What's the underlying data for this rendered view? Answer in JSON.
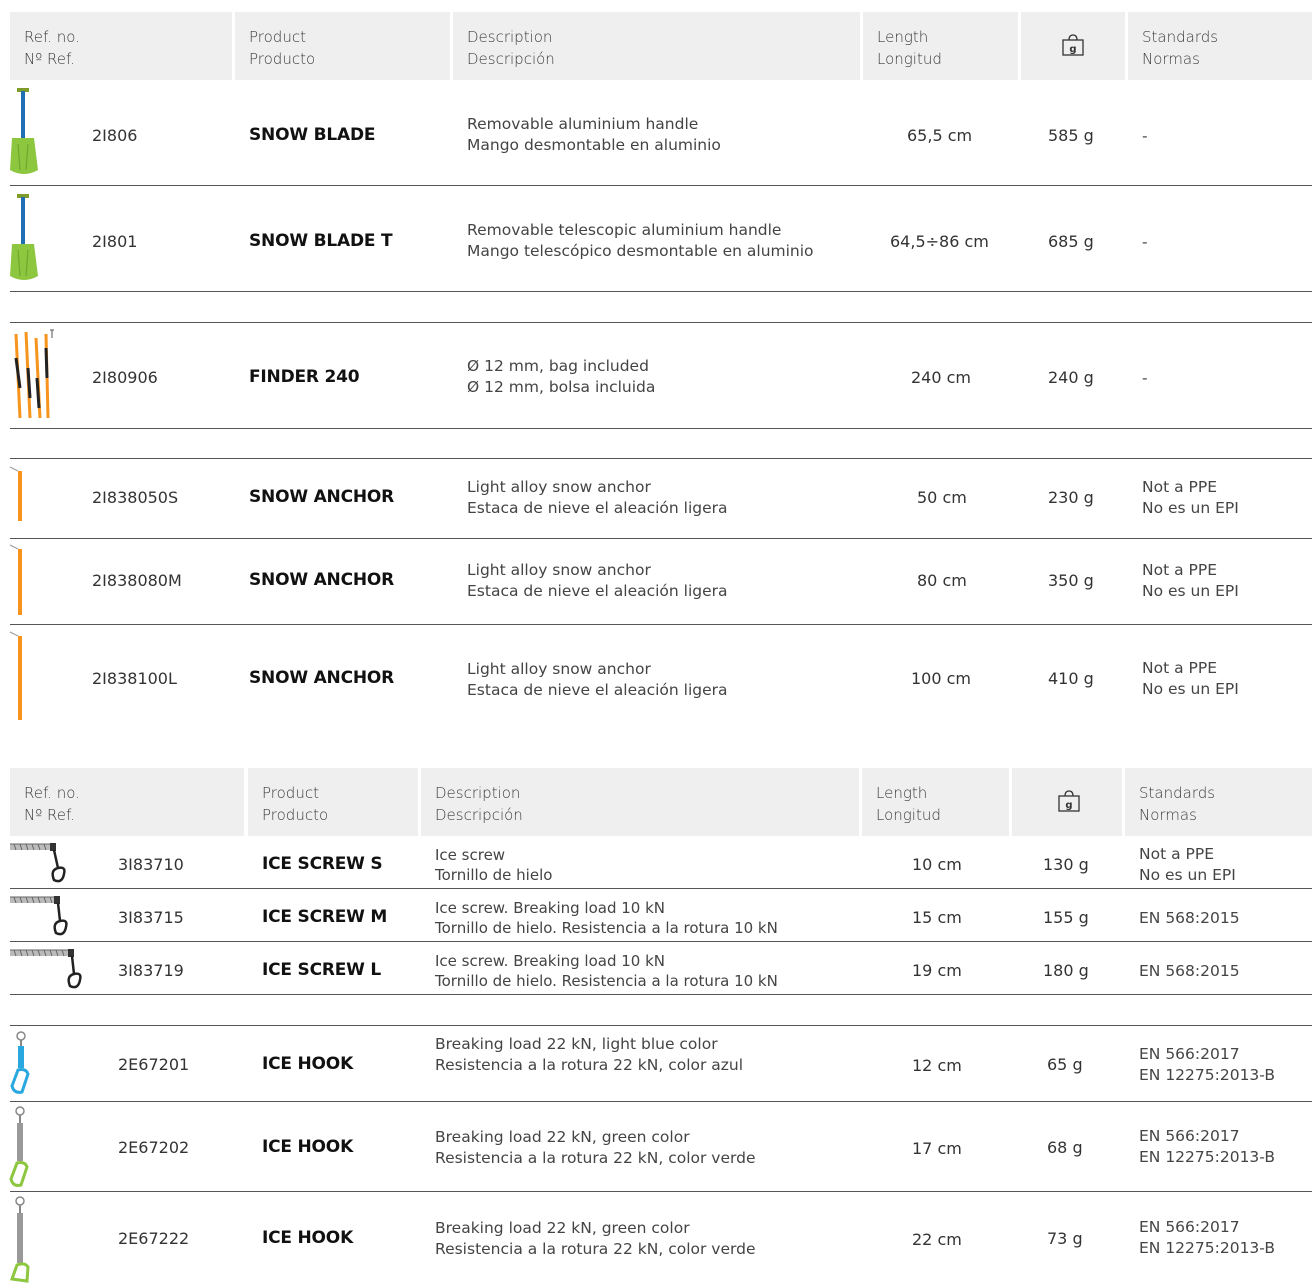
{
  "header": {
    "ref": [
      "Ref. no.",
      "Nº Ref."
    ],
    "product": [
      "Product",
      "Producto"
    ],
    "description": [
      "Description",
      "Descripción"
    ],
    "length": [
      "Length",
      "Longitud"
    ],
    "weight_icon_text": "g",
    "standards": [
      "Standards",
      "Normas"
    ]
  },
  "table1": {
    "rows": [
      {
        "ref": "2I806",
        "product": "SNOW BLADE",
        "desc": [
          "Removable aluminium handle",
          "Mango desmontable en aluminio"
        ],
        "length": "65,5 cm",
        "weight": "585 g",
        "std": [
          "-"
        ]
      },
      {
        "ref": "2I801",
        "product": "SNOW BLADE T",
        "desc": [
          "Removable telescopic aluminium handle",
          "Mango telescópico desmontable en aluminio"
        ],
        "length": "64,5÷86 cm",
        "weight": "685 g",
        "std": [
          "-"
        ]
      },
      {
        "ref": "2I80906",
        "product": "FINDER 240",
        "desc": [
          "Ø 12 mm, bag included",
          "Ø 12 mm, bolsa incluida"
        ],
        "length": "240 cm",
        "weight": "240 g",
        "std": [
          "-"
        ]
      },
      {
        "ref": "2I838050S",
        "product": "SNOW ANCHOR",
        "desc": [
          "Light alloy snow anchor",
          "Estaca de nieve el aleación ligera"
        ],
        "length": "50 cm",
        "weight": "230 g",
        "std": [
          "Not a PPE",
          "No es un EPI"
        ]
      },
      {
        "ref": "2I838080M",
        "product": "SNOW ANCHOR",
        "desc": [
          "Light alloy snow anchor",
          "Estaca de nieve el aleación ligera"
        ],
        "length": "80 cm",
        "weight": "350 g",
        "std": [
          "Not a PPE",
          "No es un EPI"
        ]
      },
      {
        "ref": "2I838100L",
        "product": "SNOW ANCHOR",
        "desc": [
          "Light alloy snow anchor",
          "Estaca de nieve el aleación ligera"
        ],
        "length": "100 cm",
        "weight": "410 g",
        "std": [
          "Not a PPE",
          "No es un EPI"
        ]
      }
    ]
  },
  "table2": {
    "rows": [
      {
        "ref": "3I83710",
        "product": "ICE SCREW S",
        "desc": [
          "Ice screw",
          "Tornillo de hielo"
        ],
        "length": "10 cm",
        "weight": "130 g",
        "std": [
          "Not a PPE",
          "No es un EPI"
        ]
      },
      {
        "ref": "3I83715",
        "product": "ICE SCREW M",
        "desc": [
          "Ice screw. Breaking load 10 kN",
          "Tornillo de hielo. Resistencia a la rotura 10 kN"
        ],
        "length": "15 cm",
        "weight": "155 g",
        "std": [
          "EN 568:2015"
        ]
      },
      {
        "ref": "3I83719",
        "product": "ICE SCREW L",
        "desc": [
          "Ice screw. Breaking load 10 kN",
          "Tornillo de hielo. Resistencia a la rotura 10 kN"
        ],
        "length": "19 cm",
        "weight": "180 g",
        "std": [
          "EN 568:2015"
        ]
      },
      {
        "ref": "2E67201",
        "product": "ICE HOOK",
        "desc": [
          "Breaking load 22 kN, light blue color",
          "Resistencia a la rotura 22 kN, color azul"
        ],
        "length": "12 cm",
        "weight": "65 g",
        "std": [
          "EN 566:2017",
          "EN 12275:2013-B"
        ]
      },
      {
        "ref": "2E67202",
        "product": "ICE HOOK",
        "desc": [
          "Breaking load 22 kN, green color",
          "Resistencia a la rotura 22 kN, color verde"
        ],
        "length": "17 cm",
        "weight": "68 g",
        "std": [
          "EN 566:2017",
          "EN 12275:2013-B"
        ]
      },
      {
        "ref": "2E67222",
        "product": "ICE HOOK",
        "desc": [
          "Breaking load 22 kN, green color",
          "Resistencia a la rotura 22 kN, color verde"
        ],
        "length": "22 cm",
        "weight": "73 g",
        "std": [
          "EN 566:2017",
          "EN 12275:2013-B"
        ]
      }
    ]
  },
  "colors": {
    "header_bg": "#efefef",
    "shovel_green": "#8dc63f",
    "shovel_handle": "#1f6fb5",
    "anchor_orange": "#f7941d",
    "hook_blue": "#29a8e0"
  }
}
